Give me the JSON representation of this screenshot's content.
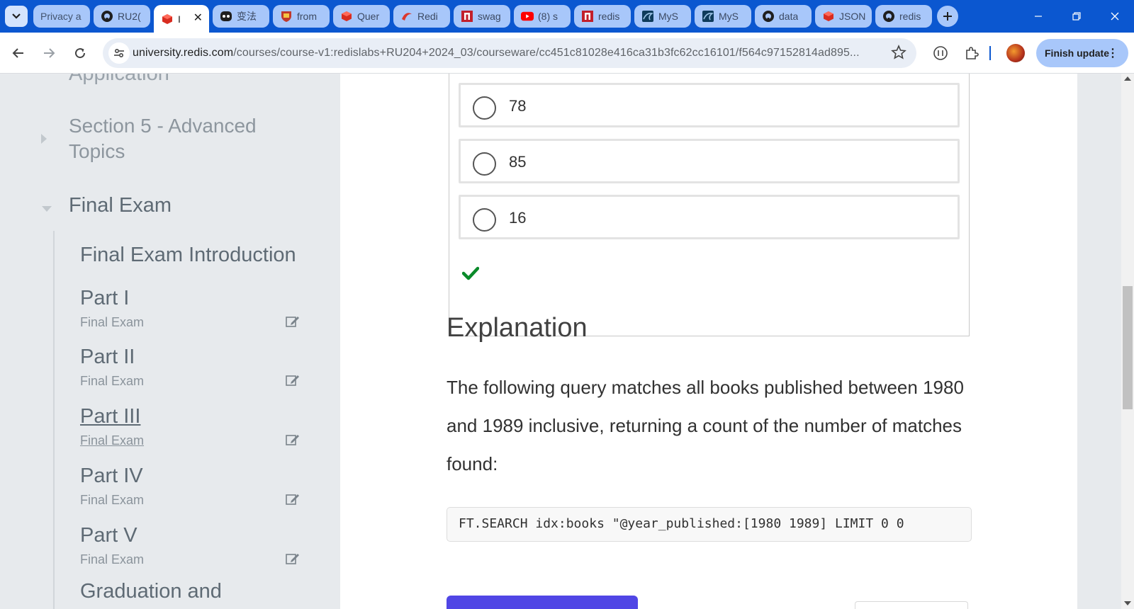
{
  "browser": {
    "tabs": [
      {
        "title": "Privacy a",
        "icon": "privacy-icon"
      },
      {
        "title": "RU2(",
        "icon": "github-icon"
      },
      {
        "title": "I",
        "icon": "redis-cube-icon",
        "active": true
      },
      {
        "title": "变法",
        "icon": "robot-icon"
      },
      {
        "title": "from",
        "icon": "crest-icon"
      },
      {
        "title": "Quer",
        "icon": "redis-cube-icon"
      },
      {
        "title": "Redi",
        "icon": "redis-logo-icon"
      },
      {
        "title": "swag",
        "icon": "n-logo-icon"
      },
      {
        "title": "(8) s",
        "icon": "youtube-icon"
      },
      {
        "title": "redis",
        "icon": "n-logo-icon"
      },
      {
        "title": "MyS",
        "icon": "mysql-icon"
      },
      {
        "title": "MyS",
        "icon": "mysql-icon"
      },
      {
        "title": "data",
        "icon": "github-icon"
      },
      {
        "title": "JSON",
        "icon": "redis-cube-icon"
      },
      {
        "title": "redis",
        "icon": "github-icon"
      }
    ],
    "url_host": "university.redis.com",
    "url_path": "/courses/course-v1:redislabs+RU204+2024_03/courseware/cc451c81028e416ca31b3fc62cc16101/f564c97152814ad895...",
    "finish_update_label": "Finish update"
  },
  "sidebar": {
    "prev_section": "Application",
    "section5": "Section 5 - Advanced Topics",
    "final_exam": "Final Exam",
    "final_intro": "Final Exam Introduction",
    "parts": [
      {
        "title": "Part I",
        "subtitle": "Final Exam"
      },
      {
        "title": "Part II",
        "subtitle": "Final Exam"
      },
      {
        "title": "Part III",
        "subtitle": "Final Exam",
        "current": true
      },
      {
        "title": "Part IV",
        "subtitle": "Final Exam"
      },
      {
        "title": "Part V",
        "subtitle": "Final Exam"
      }
    ],
    "graduation": "Graduation and"
  },
  "question": {
    "choices": [
      "78",
      "85",
      "16"
    ],
    "status": "correct"
  },
  "explanation": {
    "title": "Explanation",
    "text": "The following query matches all books published between 1980 and 1989 inclusive, returning a count of the number of matches found:",
    "code": "FT.SEARCH idx:books \"@year_published:[1980 1989] LIMIT 0 0"
  },
  "colors": {
    "chrome_blue": "#0b57d0",
    "sidebar_bg": "#e7eaed",
    "primary_button": "#5046e5",
    "check_green": "#0a8a2a"
  }
}
